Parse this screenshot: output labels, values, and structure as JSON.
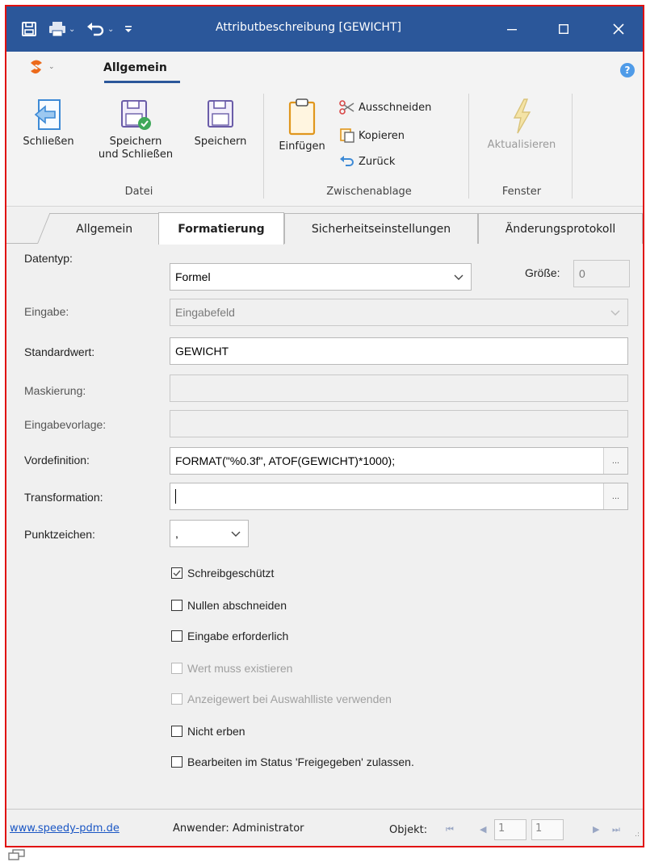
{
  "window": {
    "title": "Attributbeschreibung [GEWICHT]",
    "icons": [
      "save-icon",
      "print-icon",
      "undo-icon",
      "customize-icon"
    ],
    "controls": [
      "minimize-icon",
      "maximize-icon",
      "close-icon"
    ]
  },
  "ribbon": {
    "tab": "Allgemein",
    "help": "?",
    "groups": {
      "datei": {
        "label": "Datei",
        "close": "Schließen",
        "save_close_line1": "Speichern",
        "save_close_line2": "und Schließen",
        "save": "Speichern"
      },
      "clipboard": {
        "label": "Zwischenablage",
        "paste": "Einfügen",
        "cut": "Ausschneiden",
        "copy": "Kopieren",
        "undo": "Zurück"
      },
      "fenster": {
        "label": "Fenster",
        "refresh": "Aktualisieren"
      }
    }
  },
  "tabs": [
    {
      "label": "Allgemein",
      "active": false
    },
    {
      "label": "Formatierung",
      "active": true
    },
    {
      "label": "Sicherheitseinstellungen",
      "active": false
    },
    {
      "label": "Änderungsprotokoll",
      "active": false
    }
  ],
  "form": {
    "datentyp": {
      "label": "Datentyp:",
      "value": "Formel"
    },
    "groesse": {
      "label": "Größe:",
      "value": "0"
    },
    "eingabe": {
      "label": "Eingabe:",
      "value": "Eingabefeld"
    },
    "standardwert": {
      "label": "Standardwert:",
      "value": "GEWICHT"
    },
    "maskierung": {
      "label": "Maskierung:",
      "value": ""
    },
    "eingabevorlage": {
      "label": "Eingabevorlage:",
      "value": ""
    },
    "vordefinition": {
      "label": "Vordefinition:",
      "value": "FORMAT(\"%0.3f\", ATOF(GEWICHT)*1000);",
      "button": "..."
    },
    "transformation": {
      "label": "Transformation:",
      "value": "",
      "button": "..."
    },
    "punktzeichen": {
      "label": "Punktzeichen:",
      "value": ","
    }
  },
  "checkboxes": [
    {
      "label": "Schreibgeschützt",
      "checked": true,
      "enabled": true
    },
    {
      "label": "Nullen abschneiden",
      "checked": false,
      "enabled": true
    },
    {
      "label": "Eingabe erforderlich",
      "checked": false,
      "enabled": true
    },
    {
      "label": "Wert muss existieren",
      "checked": false,
      "enabled": false
    },
    {
      "label": "Anzeigewert bei Auswahlliste verwenden",
      "checked": false,
      "enabled": false
    },
    {
      "label": "Nicht erben",
      "checked": false,
      "enabled": true
    },
    {
      "label": "Bearbeiten im Status 'Freigegeben' zulassen.",
      "checked": false,
      "enabled": true
    }
  ],
  "status": {
    "link": "www.speedy-pdm.de",
    "user": "Anwender: Administrator",
    "object_label": "Objekt:",
    "current": "1",
    "total": "1"
  },
  "colors": {
    "titlebar": "#2b579a",
    "window_border": "#e01010",
    "link": "#1a56c4"
  }
}
